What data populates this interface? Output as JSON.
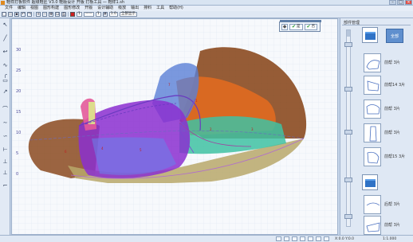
{
  "window": {
    "title": "鞋样打板软件 超级鞋匠 V3.0 鞋版设计 开版 打板工具 — 鞋样1.sh",
    "minimize": "–",
    "maximize": "□",
    "close": "×"
  },
  "menu": [
    "文件",
    "编辑",
    "视图",
    "图形构建",
    "图形修改",
    "开版",
    "设计辅助",
    "级放",
    "输出",
    "排料",
    "工具",
    "帮助(H)"
  ],
  "toolbar": {
    "line_width": "1",
    "line_style": "——",
    "snap": "1",
    "zoom": "1.0",
    "mode": "全部显示"
  },
  "left_tools": [
    "↖",
    "╱",
    "↩",
    "∿",
    "╭",
    "▭",
    "↗",
    "⌒",
    "∼",
    "∽",
    "⊢",
    "⊥",
    "⊥",
    "⌐"
  ],
  "y_axis": [
    "30",
    "25",
    "20",
    "15",
    "10",
    "5",
    "0"
  ],
  "confirm": {
    "yes": "是",
    "no": "否"
  },
  "right_panel": {
    "title": "部件管理",
    "all_button": "全部",
    "pieces": [
      {
        "label": "前帮 3片"
      },
      {
        "label": "前帮14 3片"
      },
      {
        "label": "前帮 3片"
      },
      {
        "label": "前帮 3片"
      },
      {
        "label": "前帮15 3片"
      },
      {
        "label": "后帮 3片"
      },
      {
        "label": "前帮 3片"
      }
    ]
  },
  "status": {
    "coords": "X:0.0 Y:0.0",
    "scale": "1:1.000"
  },
  "colors": {
    "orange": "#e06a20",
    "brown": "#8b4a20",
    "purple": "#8b2fd0",
    "blue": "#5a7fd6",
    "teal": "#3fc2a2",
    "olive": "#b8a86a",
    "pink": "#e35a9a"
  }
}
